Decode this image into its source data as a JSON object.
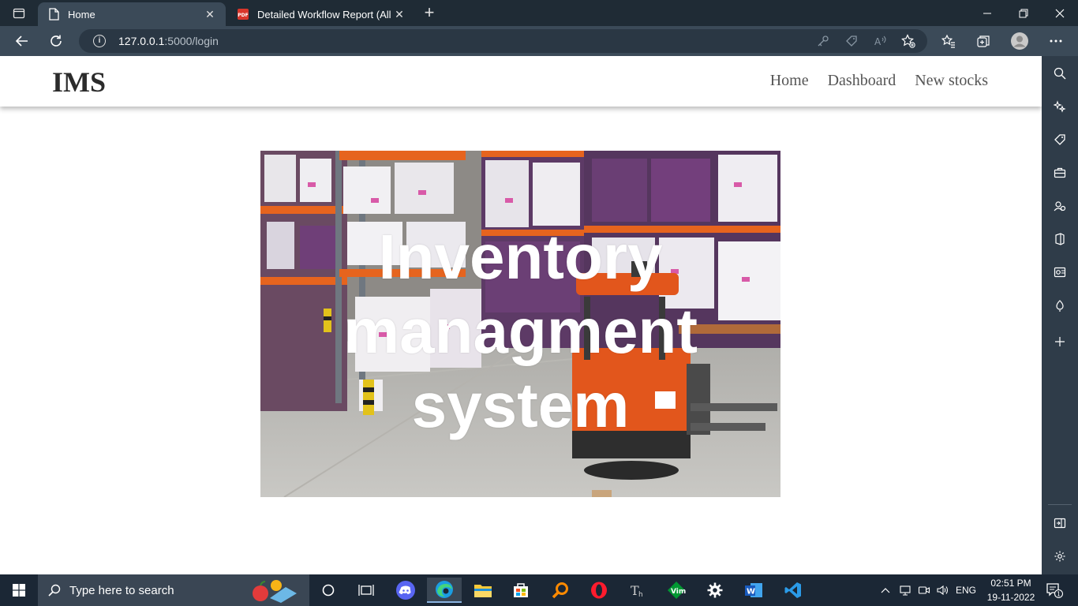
{
  "browser": {
    "tabs": [
      {
        "title": "Home",
        "active": true,
        "icon": "page-icon"
      },
      {
        "title": "Detailed Workflow Report (All Sp",
        "active": false,
        "icon": "pdf-icon"
      }
    ],
    "address": {
      "host": "127.0.0.1",
      "path": ":5000/login"
    }
  },
  "site": {
    "brand": "IMS",
    "nav": [
      "Home",
      "Dashboard",
      "New stocks"
    ],
    "hero": {
      "lines": [
        "Inventory",
        "managment",
        "system"
      ],
      "image": "warehouse-shelves-forklift-photo"
    }
  },
  "taskbar": {
    "search_placeholder": "Type here to search",
    "language": "ENG",
    "time": "02:51 PM",
    "date": "19-11-2022",
    "notification_count": "1"
  },
  "colors": {
    "titlebar": "#1f2b35",
    "toolbar": "#3b4a58",
    "sidebar": "#2f3c49",
    "taskbar": "#1b2735",
    "forklift": "#e2561c",
    "shelf": "#e6641e"
  }
}
